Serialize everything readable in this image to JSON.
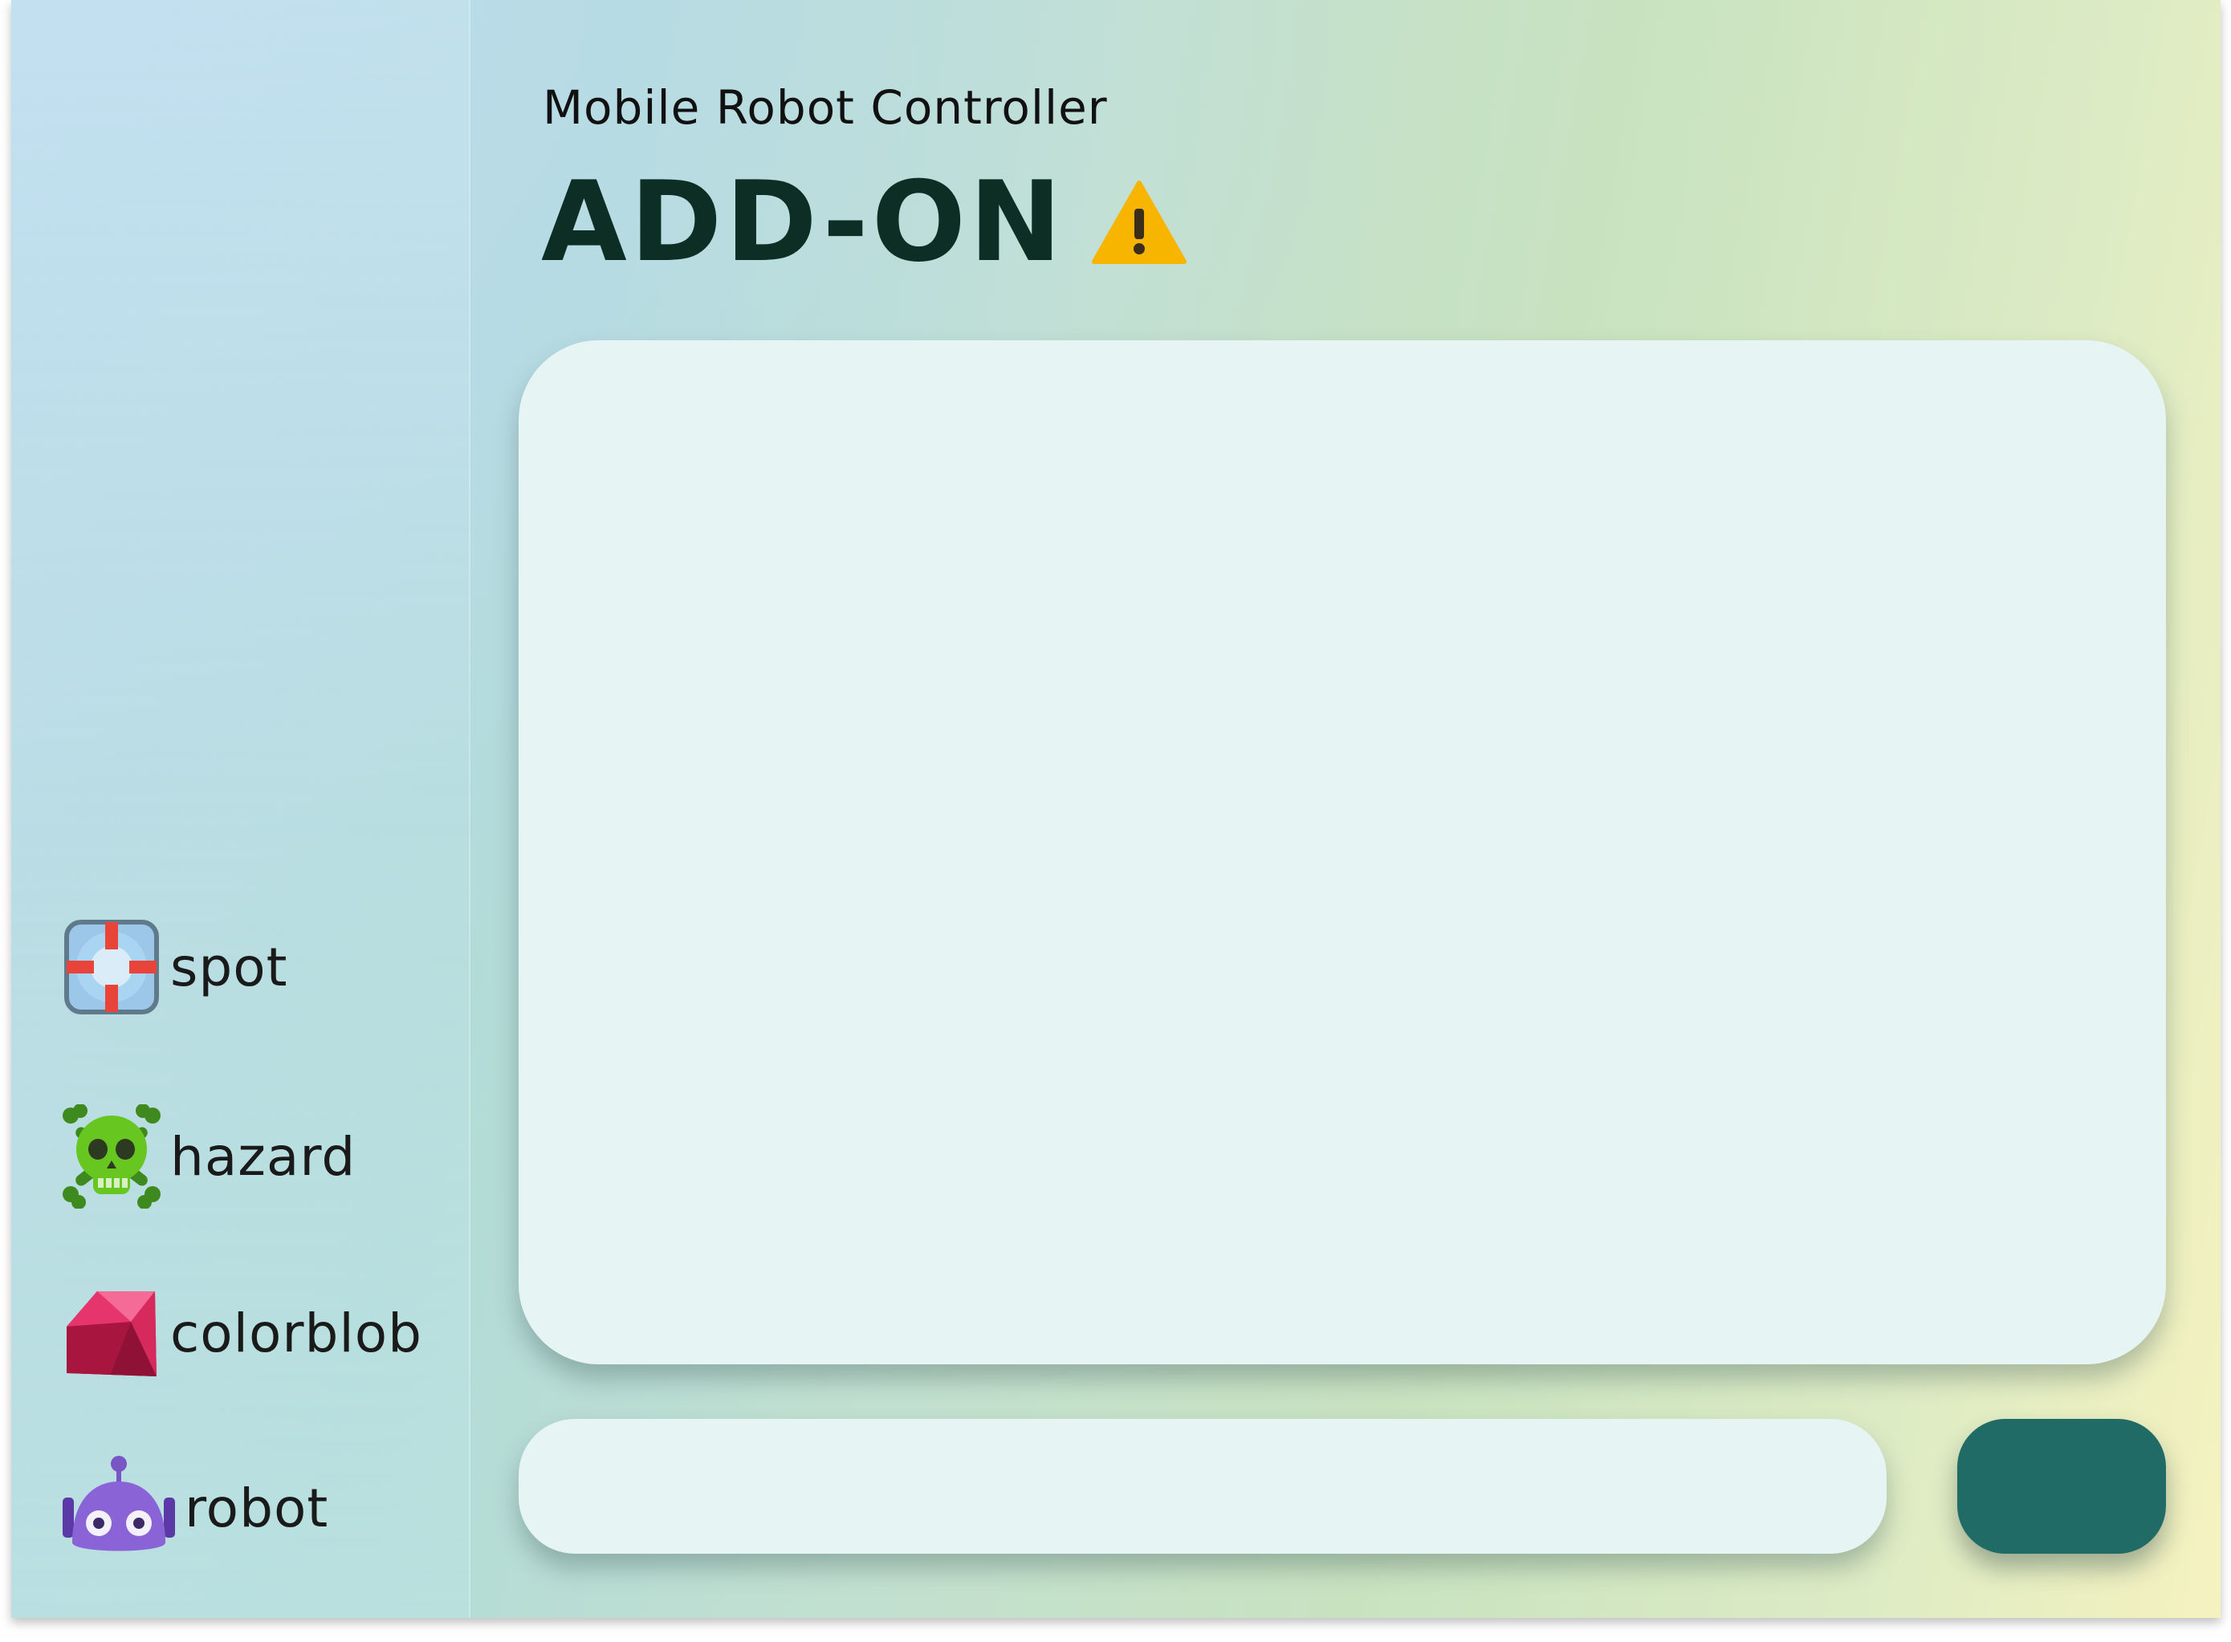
{
  "app": {
    "subtitle": "Mobile Robot Controller",
    "title": "ADD-ON",
    "title_icon": "warning-icon"
  },
  "sidebar": {
    "items": [
      {
        "label": "spot",
        "icon": "lifebuoy-icon"
      },
      {
        "label": "hazard",
        "icon": "skull-crossbones-icon"
      },
      {
        "label": "colorblob",
        "icon": "gem-icon"
      },
      {
        "label": "robot",
        "icon": "robot-icon"
      }
    ]
  },
  "chat": {
    "input_value": "",
    "send_label": ""
  },
  "colors": {
    "title": "#0c2e24",
    "panel": "#e6f5f4",
    "send_button": "#216b66"
  }
}
